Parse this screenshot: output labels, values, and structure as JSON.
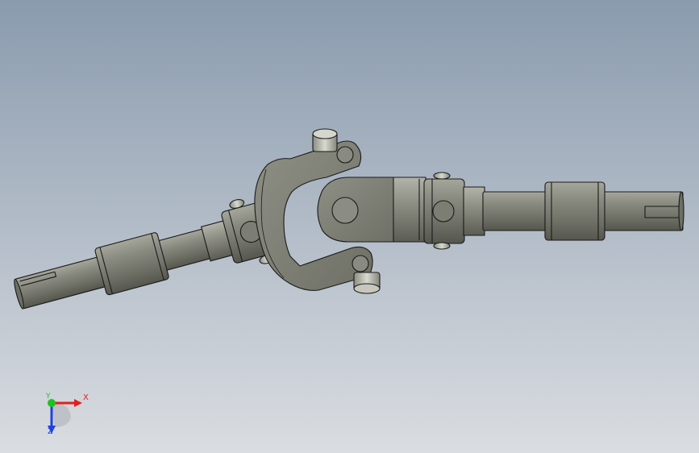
{
  "viewport": {
    "background_top": "#8a9bae",
    "background_bottom": "#dadde1"
  },
  "part": {
    "body_color": "#7a7b70",
    "edge_color": "#1a1a1a"
  },
  "triad": {
    "x_label": "X",
    "y_label": "Y",
    "z_label": "Z",
    "x_color": "#e02020",
    "y_color": "#20c020",
    "z_color": "#2040e0"
  }
}
